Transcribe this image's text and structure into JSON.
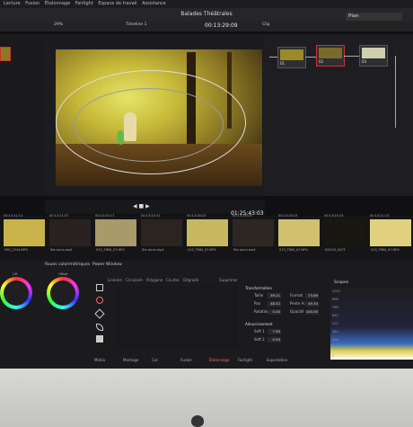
{
  "menu": [
    "Lecture",
    "Fusion",
    "Étalonnage",
    "Fairlight",
    "Espace de travail",
    "Assistance"
  ],
  "window": {
    "title": "Balades Théâtrales",
    "timeline": "Timeline 1"
  },
  "toolbar": {
    "timecode_top": "00:13:29:09",
    "clip_menu": "Clip",
    "zoom": "29%",
    "plan": "Plan"
  },
  "nodes": [
    {
      "id": "01"
    },
    {
      "id": "02"
    },
    {
      "id": "03"
    }
  ],
  "viewer": {
    "timecode": "01:25:43:03",
    "tc_left": "00:13:29:09"
  },
  "clips": [
    {
      "num": "01",
      "tc": "00:13:21:11",
      "label": "IMG_2344.MP4"
    },
    {
      "num": "02",
      "tc": "00:13:21:07",
      "label": "Ste anne.mp4"
    },
    {
      "num": "03",
      "tc": "00:13:20:17",
      "label": "015_TRIM_07.MP4"
    },
    {
      "num": "04",
      "tc": "00:13:20:31",
      "label": "Ste anne.mp4"
    },
    {
      "num": "05",
      "tc": "00:13:28:23",
      "label": "015_TRIM_07.MP4"
    },
    {
      "num": "06",
      "tc": "00:13:16:19",
      "label": "Ste anne.mp4"
    },
    {
      "num": "07",
      "tc": "00:13:25:13",
      "label": "013_TRIM_07.MP4"
    },
    {
      "num": "08",
      "tc": "00:13:20:13",
      "label": "DSC09_0473"
    },
    {
      "num": "09",
      "tc": "00:13:21:13",
      "label": "015_TRIM_07.MP4"
    }
  ],
  "color_panel": {
    "wheels_header": "Roues colorimétriques",
    "power_window": "Power Window",
    "tabs": [
      "Linéaire",
      "Circulaire",
      "Polygone",
      "Courbe",
      "Dégradé"
    ],
    "remove": "Supprimer",
    "wheel_labels": [
      "Lift",
      "Offset"
    ]
  },
  "transform": {
    "title": "Transformation",
    "rows": [
      {
        "label": "Taille",
        "value": "39.21",
        "label2": "Format",
        "value2": "73.69"
      },
      {
        "label": "Pan",
        "value": "48.52",
        "label2": "Pente H.",
        "value2": "49.34"
      },
      {
        "label": "Rotation",
        "value": "0.00",
        "label2": "Opacité",
        "value2": "100.00"
      }
    ],
    "soft_title": "Adoucissement",
    "soft_rows": [
      {
        "label": "Soft 1",
        "value": "7.90"
      },
      {
        "label": "Soft 2",
        "value": "0.50"
      }
    ]
  },
  "scopes": {
    "title": "Scopes",
    "scale": [
      "1023",
      "896",
      "768",
      "640",
      "512",
      "384",
      "256",
      "128",
      "0"
    ]
  },
  "bottom_tabs": [
    "Média",
    "Montage",
    "Cut",
    "Fusion",
    "Étalonnage",
    "Fairlight",
    "Exportation"
  ],
  "colors": {
    "accent": "#f06a6a",
    "selected_border": "#cc3333"
  }
}
